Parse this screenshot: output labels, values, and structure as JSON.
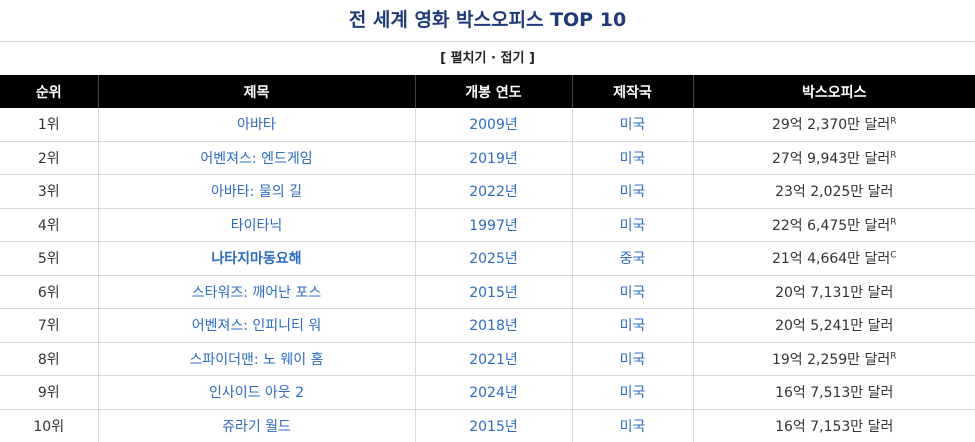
{
  "title": "전 세계 영화 박스오피스 TOP 10",
  "toggle": {
    "open_bracket": "[",
    "expand_label": "펼치기",
    "separator": "·",
    "collapse_label": "접기",
    "close_bracket": "]"
  },
  "table": {
    "headers": [
      "순위",
      "제목",
      "개봉 연도",
      "제작국",
      "박스오피스"
    ],
    "rows": [
      {
        "rank": "1위",
        "title": "아바타",
        "year": "2009년",
        "country": "미국",
        "gross": "29억 2,370만 달러",
        "mark": "R",
        "bold": false
      },
      {
        "rank": "2위",
        "title": "어벤져스: 엔드게임",
        "year": "2019년",
        "country": "미국",
        "gross": "27억 9,943만 달러",
        "mark": "R",
        "bold": false
      },
      {
        "rank": "3위",
        "title": "아바타: 물의 길",
        "year": "2022년",
        "country": "미국",
        "gross": "23억 2,025만 달러",
        "mark": "",
        "bold": false
      },
      {
        "rank": "4위",
        "title": "타이타닉",
        "year": "1997년",
        "country": "미국",
        "gross": "22억 6,475만 달러",
        "mark": "R",
        "bold": false
      },
      {
        "rank": "5위",
        "title": "나타지마동요해",
        "year": "2025년",
        "country": "중국",
        "gross": "21억 4,664만 달러",
        "mark": "C",
        "bold": true
      },
      {
        "rank": "6위",
        "title": "스타워즈: 깨어난 포스",
        "year": "2015년",
        "country": "미국",
        "gross": "20억 7,131만 달러",
        "mark": "",
        "bold": false
      },
      {
        "rank": "7위",
        "title": "어벤져스: 인피니티 워",
        "year": "2018년",
        "country": "미국",
        "gross": "20억 5,241만 달러",
        "mark": "",
        "bold": false
      },
      {
        "rank": "8위",
        "title": "스파이더맨: 노 웨이 홈",
        "year": "2021년",
        "country": "미국",
        "gross": "19억 2,259만 달러",
        "mark": "R",
        "bold": false
      },
      {
        "rank": "9위",
        "title": "인사이드 아웃 2",
        "year": "2024년",
        "country": "미국",
        "gross": "16억 7,513만 달러",
        "mark": "",
        "bold": false
      },
      {
        "rank": "10위",
        "title": "쥬라기 월드",
        "year": "2015년",
        "country": "미국",
        "gross": "16억 7,153만 달러",
        "mark": "",
        "bold": false
      }
    ]
  },
  "colors": {
    "title": "#1f3b7a",
    "header_bg": "#000000",
    "header_text": "#ffffff",
    "link": "#2b6bc4",
    "border": "#d9d9d9"
  }
}
